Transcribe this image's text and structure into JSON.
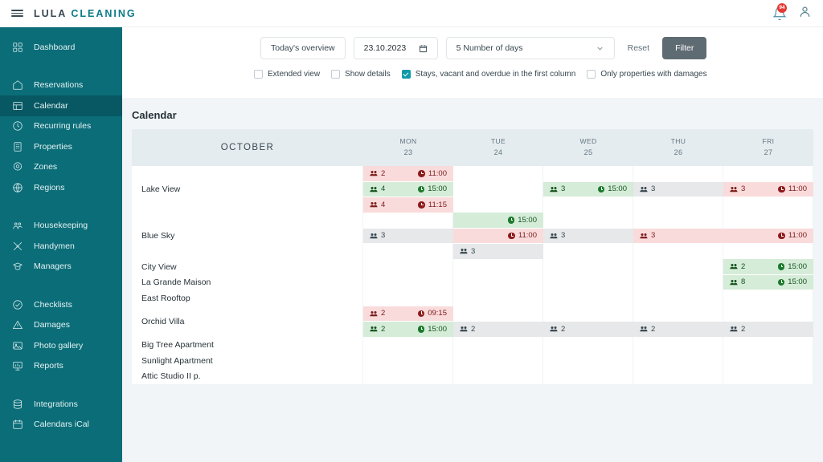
{
  "app": {
    "brand_lula": "LULA",
    "brand_cleaning": "CLEANING",
    "notifications_badge": "94"
  },
  "sidebar": {
    "groups": [
      {
        "items": [
          {
            "label": "Dashboard",
            "icon": "grid-icon",
            "active": false
          }
        ]
      },
      {
        "items": [
          {
            "label": "Reservations",
            "icon": "home-icon",
            "active": false
          },
          {
            "label": "Calendar",
            "icon": "table-icon",
            "active": true
          },
          {
            "label": "Recurring rules",
            "icon": "clock-icon",
            "active": false
          },
          {
            "label": "Properties",
            "icon": "building-icon",
            "active": false
          },
          {
            "label": "Zones",
            "icon": "pin-icon",
            "active": false
          },
          {
            "label": "Regions",
            "icon": "globe-icon",
            "active": false
          }
        ]
      },
      {
        "items": [
          {
            "label": "Housekeeping",
            "icon": "people-icon",
            "active": false
          },
          {
            "label": "Handymen",
            "icon": "tools-icon",
            "active": false
          },
          {
            "label": "Managers",
            "icon": "manager-icon",
            "active": false
          }
        ]
      },
      {
        "items": [
          {
            "label": "Checklists",
            "icon": "check-circle-icon",
            "active": false
          },
          {
            "label": "Damages",
            "icon": "warning-icon",
            "active": false
          },
          {
            "label": "Photo gallery",
            "icon": "image-icon",
            "active": false
          },
          {
            "label": "Reports",
            "icon": "report-icon",
            "active": false
          }
        ]
      },
      {
        "items": [
          {
            "label": "Integrations",
            "icon": "database-icon",
            "active": false
          },
          {
            "label": "Calendars iCal",
            "icon": "calendar-icon",
            "active": false
          }
        ]
      }
    ]
  },
  "filters": {
    "overview_label": "Today's overview",
    "date_value": "23.10.2023",
    "days_value": "5 Number of days",
    "reset_label": "Reset",
    "filter_label": "Filter",
    "checkboxes": [
      {
        "label": "Extended view",
        "checked": false
      },
      {
        "label": "Show details",
        "checked": false
      },
      {
        "label": "Stays, vacant and overdue in the first column",
        "checked": true
      },
      {
        "label": "Only properties with damages",
        "checked": false
      }
    ]
  },
  "calendar": {
    "title": "Calendar",
    "month": "OCTOBER",
    "days": [
      {
        "name": "MON",
        "num": "23"
      },
      {
        "name": "TUE",
        "num": "24"
      },
      {
        "name": "WED",
        "num": "25"
      },
      {
        "name": "THU",
        "num": "26"
      },
      {
        "name": "FRI",
        "num": "27"
      }
    ],
    "rows": [
      {
        "property": "Lake View",
        "height": 58,
        "segments": [
          {
            "day": 0,
            "span": 1,
            "lane": 0,
            "type": "red",
            "guests": "2",
            "time": "11:00",
            "clock": "r"
          },
          {
            "day": 0,
            "span": 1,
            "lane": 1,
            "type": "green",
            "guests": "4",
            "time": "15:00",
            "clock": "g"
          },
          {
            "day": 0,
            "span": 1,
            "lane": 2,
            "type": "red",
            "guests": "4",
            "time": "11:15",
            "clock": "r"
          },
          {
            "day": 2,
            "span": 1,
            "lane": 1,
            "type": "green",
            "guests": "3",
            "time": "15:00",
            "clock": "g"
          },
          {
            "day": 3,
            "span": 2,
            "lane": 1,
            "type": "grey",
            "guests": "3",
            "time": "",
            "clock": ""
          },
          {
            "day": 4,
            "span": 1,
            "lane": 1,
            "type": "red",
            "guests": "3",
            "time": "11:00",
            "clock": "r"
          }
        ]
      },
      {
        "property": "Blue Sky",
        "height": 58,
        "segments": [
          {
            "day": 0,
            "span": 1,
            "lane": 1,
            "type": "grey",
            "guests": "3",
            "time": "",
            "clock": ""
          },
          {
            "day": 1,
            "span": 1,
            "lane": 0,
            "type": "green",
            "guests": "",
            "time": "15:00",
            "clock": "g"
          },
          {
            "day": 1,
            "span": 1,
            "lane": 1,
            "type": "red",
            "guests": "",
            "time": "11:00",
            "clock": "r"
          },
          {
            "day": 1,
            "span": 1,
            "lane": 2,
            "type": "grey",
            "guests": "3",
            "time": "",
            "clock": ""
          },
          {
            "day": 2,
            "span": 2,
            "lane": 1,
            "type": "grey",
            "guests": "3",
            "time": "",
            "clock": ""
          },
          {
            "day": 3,
            "span": 2,
            "lane": 1,
            "type": "red",
            "guests": "3",
            "time": "11:00",
            "clock": "r"
          }
        ]
      },
      {
        "property": "City View",
        "height": 19.5,
        "segments": [
          {
            "day": 4,
            "span": 1,
            "lane": 0,
            "type": "green",
            "guests": "2",
            "time": "15:00",
            "clock": "g"
          }
        ]
      },
      {
        "property": "La Grande Maison",
        "height": 19.5,
        "segments": [
          {
            "day": 4,
            "span": 1,
            "lane": 0,
            "type": "green",
            "guests": "8",
            "time": "15:00",
            "clock": "g"
          }
        ]
      },
      {
        "property": "East Rooftop",
        "height": 19.5,
        "segments": []
      },
      {
        "property": "Orchid Villa",
        "height": 39,
        "segments": [
          {
            "day": 0,
            "span": 1,
            "lane": 0,
            "type": "red",
            "guests": "2",
            "time": "09:15",
            "clock": "r"
          },
          {
            "day": 0,
            "span": 1,
            "lane": 1,
            "type": "green",
            "guests": "2",
            "time": "15:00",
            "clock": "g"
          },
          {
            "day": 1,
            "span": 4,
            "lane": 1,
            "type": "grey",
            "guests": "2",
            "time": "",
            "clock": ""
          },
          {
            "day": 2,
            "span": 1,
            "lane": 1,
            "type": "grey",
            "guests": "2",
            "time": "",
            "clock": ""
          },
          {
            "day": 3,
            "span": 1,
            "lane": 1,
            "type": "grey",
            "guests": "2",
            "time": "",
            "clock": ""
          },
          {
            "day": 4,
            "span": 1,
            "lane": 1,
            "type": "grey",
            "guests": "2",
            "time": "",
            "clock": ""
          }
        ]
      },
      {
        "property": "Big Tree Apartment",
        "height": 19.5,
        "segments": []
      },
      {
        "property": "Sunlight Apartment",
        "height": 19.5,
        "segments": []
      },
      {
        "property": "Attic Studio II p.",
        "height": 19.5,
        "segments": []
      }
    ]
  }
}
